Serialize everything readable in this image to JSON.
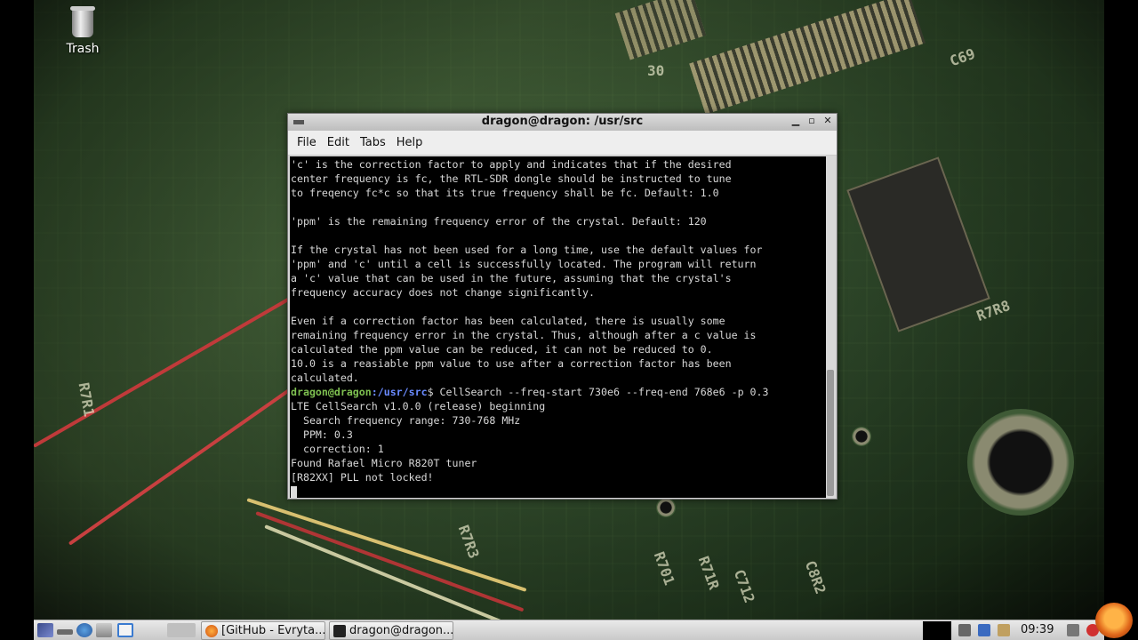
{
  "desktop": {
    "trash_label": "Trash"
  },
  "terminal": {
    "title": "dragon@dragon: /usr/src",
    "menu": [
      "File",
      "Edit",
      "Tabs",
      "Help"
    ],
    "text_lines": [
      "'c' is the correction factor to apply and indicates that if the desired",
      "center frequency is fc, the RTL-SDR dongle should be instructed to tune",
      "to freqency fc*c so that its true frequency shall be fc. Default: 1.0",
      "",
      "'ppm' is the remaining frequency error of the crystal. Default: 120",
      "",
      "If the crystal has not been used for a long time, use the default values for",
      "'ppm' and 'c' until a cell is successfully located. The program will return",
      "a 'c' value that can be used in the future, assuming that the crystal's",
      "frequency accuracy does not change significantly.",
      "",
      "Even if a correction factor has been calculated, there is usually some",
      "remaining frequency error in the crystal. Thus, although after a c value is",
      "calculated the ppm value can be reduced, it can not be reduced to 0.",
      "10.0 is a reasiable ppm value to use after a correction factor has been",
      "calculated."
    ],
    "prompt_user": "dragon@dragon",
    "prompt_path": ":/usr/src",
    "prompt_command": "$ CellSearch --freq-start 730e6 --freq-end 768e6 -p 0.3",
    "output_lines": [
      "LTE CellSearch v1.0.0 (release) beginning",
      "  Search frequency range: 730-768 MHz",
      "  PPM: 0.3",
      "  correction: 1",
      "Found Rafael Micro R820T tuner",
      "[R82XX] PLL not locked!"
    ]
  },
  "taskbar": {
    "tasks": [
      "[GitHub - Evryta...",
      "dragon@dragon..."
    ],
    "clock": "09:39"
  },
  "background_text": [
    "30",
    "C69",
    "R7R1",
    "R7R8",
    "C8R2",
    "R701",
    "R71R",
    "C712",
    "R7R3"
  ]
}
